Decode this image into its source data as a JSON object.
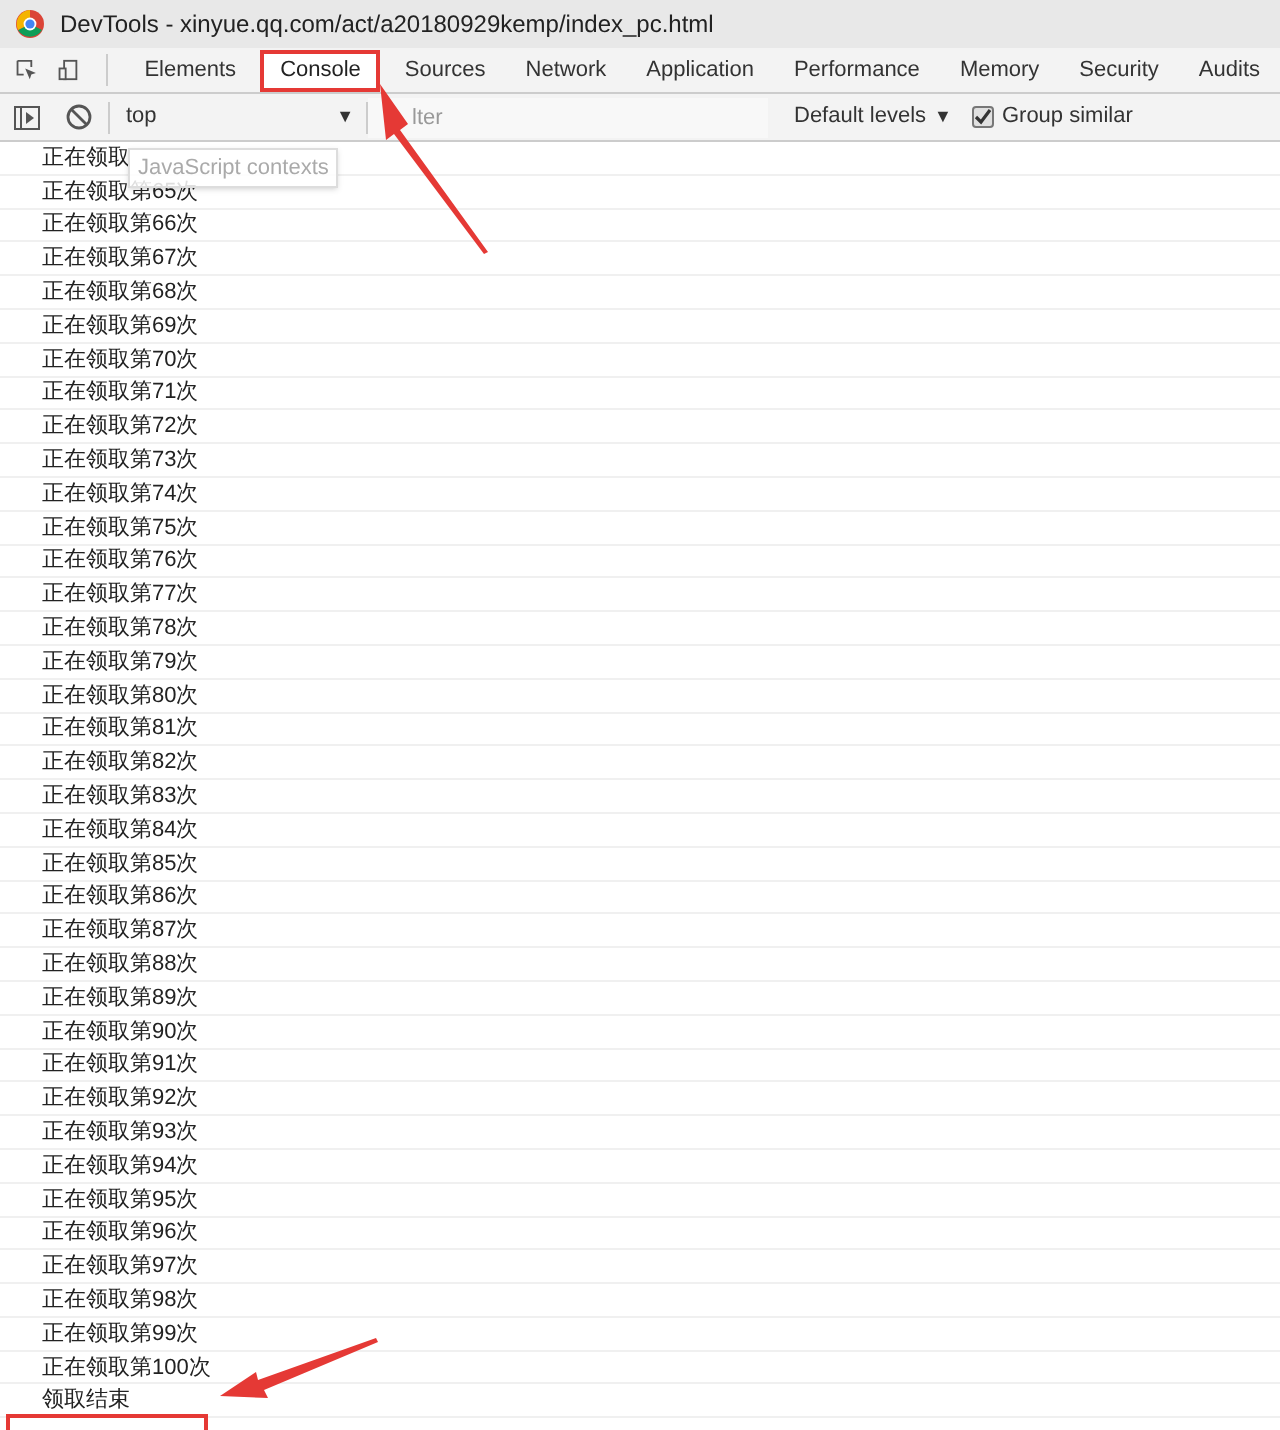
{
  "window": {
    "title": "DevTools - xinyue.qq.com/act/a20180929kemp/index_pc.html"
  },
  "tabs": [
    {
      "label": "Elements",
      "selected": false
    },
    {
      "label": "Console",
      "selected": true
    },
    {
      "label": "Sources",
      "selected": false
    },
    {
      "label": "Network",
      "selected": false
    },
    {
      "label": "Application",
      "selected": false
    },
    {
      "label": "Performance",
      "selected": false
    },
    {
      "label": "Memory",
      "selected": false
    },
    {
      "label": "Security",
      "selected": false
    },
    {
      "label": "Audits",
      "selected": false
    }
  ],
  "toolbar": {
    "context": "top",
    "context_caret": "▼",
    "filter": {
      "placeholder": "lter"
    },
    "levels": "Default levels",
    "levels_caret": "▼",
    "group_similar": {
      "label": "Group similar",
      "checked": true
    }
  },
  "tooltip": "JavaScript contexts",
  "messages": [
    "正在领取",
    "正在领取第65次",
    "正在领取第66次",
    "正在领取第67次",
    "正在领取第68次",
    "正在领取第69次",
    "正在领取第70次",
    "正在领取第71次",
    "正在领取第72次",
    "正在领取第73次",
    "正在领取第74次",
    "正在领取第75次",
    "正在领取第76次",
    "正在领取第77次",
    "正在领取第78次",
    "正在领取第79次",
    "正在领取第80次",
    "正在领取第81次",
    "正在领取第82次",
    "正在领取第83次",
    "正在领取第84次",
    "正在领取第85次",
    "正在领取第86次",
    "正在领取第87次",
    "正在领取第88次",
    "正在领取第89次",
    "正在领取第90次",
    "正在领取第91次",
    "正在领取第92次",
    "正在领取第93次",
    "正在领取第94次",
    "正在领取第95次",
    "正在领取第96次",
    "正在领取第97次",
    "正在领取第98次",
    "正在领取第99次",
    "正在领取第100次",
    "领取结束"
  ]
}
